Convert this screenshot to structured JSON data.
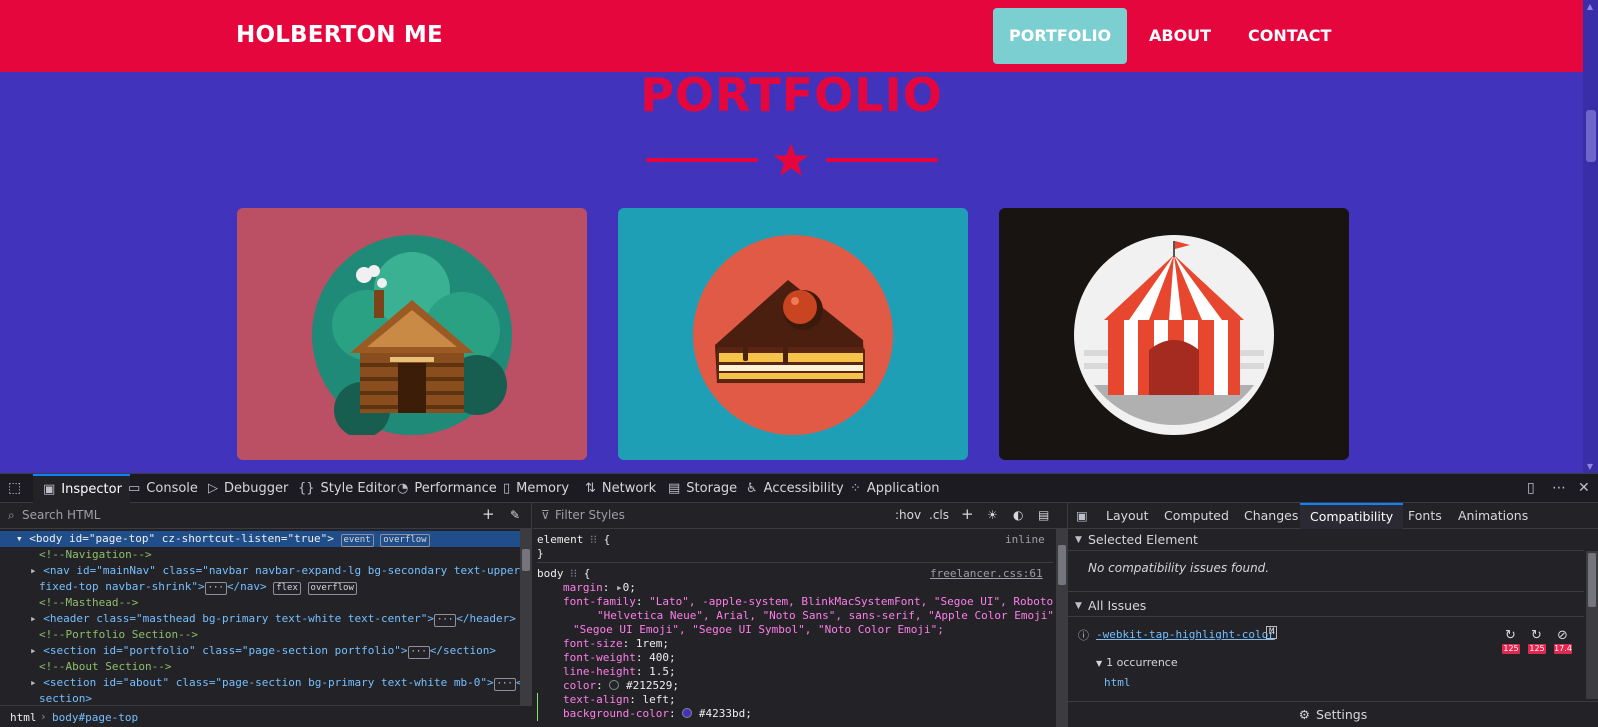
{
  "navbar": {
    "brand": "HOLBERTON ME",
    "links": [
      "PORTFOLIO",
      "ABOUT",
      "CONTACT"
    ],
    "active": "PORTFOLIO"
  },
  "portfolio": {
    "title": "PORTFOLIO",
    "cards": [
      {
        "name": "cabin",
        "bg": "#bb5065"
      },
      {
        "name": "cake",
        "bg": "#1f9fb6"
      },
      {
        "name": "circus",
        "bg": "#171412"
      }
    ]
  },
  "colors": {
    "primary": "#4233bd",
    "secondary": "#e6063e",
    "accent": "#7ccfd1"
  },
  "devtools": {
    "tabs": [
      "Inspector",
      "Console",
      "Debugger",
      "Style Editor",
      "Performance",
      "Memory",
      "Network",
      "Storage",
      "Accessibility",
      "Application"
    ],
    "active_tab": "Inspector",
    "search_placeholder": "Search HTML",
    "html_tree": {
      "body_line": "<body id=\"page-top\" cz-shortcut-listen=\"true\">",
      "body_badges": [
        "event",
        "overflow"
      ],
      "comment_nav": "<!--Navigation-->",
      "nav_line_1": "<nav id=\"mainNav\" class=\"navbar navbar-expand-lg bg-secondary text-uppercase",
      "nav_line_2": "fixed-top navbar-shrink\">",
      "nav_close": "</nav>",
      "nav_badges": [
        "flex",
        "overflow"
      ],
      "comment_masthead": "<!--Masthead-->",
      "header_line": "<header class=\"masthead bg-primary text-white text-center\">",
      "header_close": "</header>",
      "comment_portfolio": "<!--Portfolio Section-->",
      "section_portfolio": "<section id=\"portfolio\" class=\"page-section portfolio\">",
      "section_close": "</section>",
      "comment_about": "<!--About Section-->",
      "section_about_1": "<section id=\"about\" class=\"page-section bg-primary text-white mb-0\">",
      "section_about_2": "section>",
      "about_close_prefix": "</",
      "ellipsis": "···"
    },
    "breadcrumb": [
      "html",
      "body#page-top"
    ],
    "filter_placeholder": "Filter Styles",
    "filter_buttons": [
      ":hov",
      ".cls"
    ],
    "rules": {
      "element_selector": "element",
      "element_source": "inline",
      "body_selector": "body",
      "body_source": "freelancer.css:61",
      "open_brace": "{",
      "close_brace": "}",
      "declarations": [
        {
          "prop": "margin",
          "value": "0;"
        },
        {
          "prop": "font-family",
          "value_lines": [
            "\"Lato\", -apple-system, BlinkMacSystemFont, \"Segoe UI\", Roboto,",
            "\"Helvetica Neue\", Arial, \"Noto Sans\", sans-serif, \"Apple Color Emoji\",",
            "\"Segoe UI Emoji\", \"Segoe UI Symbol\", \"Noto Color Emoji\";"
          ]
        },
        {
          "prop": "font-size",
          "value": "1rem;"
        },
        {
          "prop": "font-weight",
          "value": "400;"
        },
        {
          "prop": "line-height",
          "value": "1.5;"
        },
        {
          "prop": "color",
          "value": "#212529;"
        },
        {
          "prop": "text-align",
          "value": "left;"
        },
        {
          "prop": "background-color",
          "value": "#4233bd;"
        }
      ],
      "color_swatch": "#212529",
      "bg_swatch": "#4233bd"
    },
    "right_tabs": [
      "Layout",
      "Computed",
      "Changes",
      "Compatibility",
      "Fonts",
      "Animations"
    ],
    "right_active": "Compatibility",
    "compat": {
      "selected_element": "Selected Element",
      "no_issues": "No compatibility issues found.",
      "all_issues": "All Issues",
      "issue_property": "-webkit-tap-highlight-color",
      "issue_badge": "M",
      "occurrence": "1 occurrence",
      "occurrence_node": "html",
      "browser_versions": [
        "125",
        "125",
        "17.4"
      ]
    },
    "settings_label": "Settings"
  }
}
